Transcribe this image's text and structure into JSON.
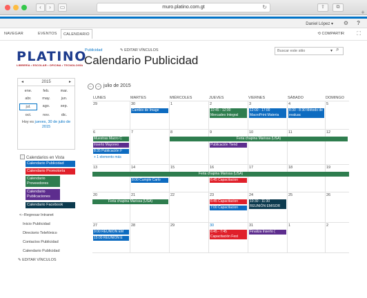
{
  "browser": {
    "url": "muro.platino.com.gt"
  },
  "suite": {
    "user": "Daniel López ▾"
  },
  "ribbon": {
    "tabs": [
      "NAVEGAR",
      "EVENTOS",
      "CALENDARIO"
    ],
    "share": "COMPARTIR"
  },
  "logo": {
    "name": "PLATINO",
    "tagline": "LIBRERÍA • ESCOLAR • OFICINA • TECNOLOGÍA"
  },
  "header": {
    "breadcrumb": "Publicidad",
    "edit_links": "EDITAR VÍNCULOS",
    "title": "Calendario Publicidad",
    "search_placeholder": "Buscar este sitio"
  },
  "mini_cal": {
    "year": "2015",
    "months": [
      "ene.",
      "feb.",
      "mar.",
      "abr.",
      "may.",
      "jun.",
      "jul.",
      "ago.",
      "sep.",
      "oct.",
      "nov.",
      "dic."
    ],
    "today_prefix": "Hoy es ",
    "today_date": "jueves, 30 de julio de 2015"
  },
  "calendars_in_view": {
    "heading": "Calendarios en Vista",
    "items": [
      {
        "label": "Calendario Publicidad",
        "color": "#0d6bc0"
      },
      {
        "label": "Calendario Promotoría",
        "color": "#e0202a"
      },
      {
        "label": "Calendario Proveedores",
        "color": "#2e7d4e"
      },
      {
        "label": "Calendario Publicaciones",
        "color": "#5d2d8e"
      },
      {
        "label": "Calendario Facebook",
        "color": "#0c3a4e"
      }
    ]
  },
  "left_nav": [
    "<--Regresar Intranet",
    "Inicio Publicidad",
    "Directorio Telefónico",
    "Contactos Publicidad",
    "Calendario Publicidad"
  ],
  "edit_links_bottom": "EDITAR VÍNCULOS",
  "calendar": {
    "month_label": "julio de 2015",
    "day_names": [
      "LUNES",
      "MARTES",
      "MIÉRCOLES",
      "JUEVES",
      "VIERNES",
      "SÁBADO",
      "DOMINGO"
    ],
    "weeks": [
      [
        "29",
        "30",
        "1",
        "2",
        "3",
        "4",
        "5"
      ],
      [
        "6",
        "7",
        "8",
        "9",
        "10",
        "11",
        "12"
      ],
      [
        "13",
        "14",
        "15",
        "16",
        "17",
        "18",
        "19"
      ],
      [
        "20",
        "21",
        "22",
        "23",
        "24",
        "25",
        "26"
      ],
      [
        "27",
        "28",
        "29",
        "30",
        "31",
        "1",
        "2"
      ]
    ],
    "events": {
      "w1_martes": "Cambio de Image",
      "w1_jueves": "10:45 - 12:00 Mercadeo Integral",
      "w1_viernes": "12:00 - 17:00 MacroPrint Materia",
      "w1_sabado": "8:30 - 8:30 Método de evaluac",
      "w2_lunes_1": "Muestras Macro C",
      "w2_feria": "Feria chapina Marissa (USA)",
      "w2_lunes_2": "Inserto Mayoreo",
      "w2_jueves": "Publicación Tiend",
      "w2_lunes_3": "8:35 Publicación F",
      "w2_more": "+ 1 elemento más",
      "w3_feria": "Feria chapina Marissa (USA)",
      "w3_martes": "8:00 Cumple Carlo",
      "w3_jueves": "6:45 Capacitacion",
      "w4_feria": "Feria chapina Marissa (USA)",
      "w4_jueves_1": "6:45 Capacitacion",
      "w4_viernes": "10:30 - 11:30 REUNIÓN EMISOR",
      "w4_jueves_2": "7:00 Capacitacion",
      "w5_lunes_1": "9:00 REUNION EM",
      "w5_lunes_2": "15:00 REUNION E",
      "w5_jueves": "6:45 - 7:45 Capacitación Fest",
      "w5_viernes": "Finaliza Inserto ("
    }
  }
}
